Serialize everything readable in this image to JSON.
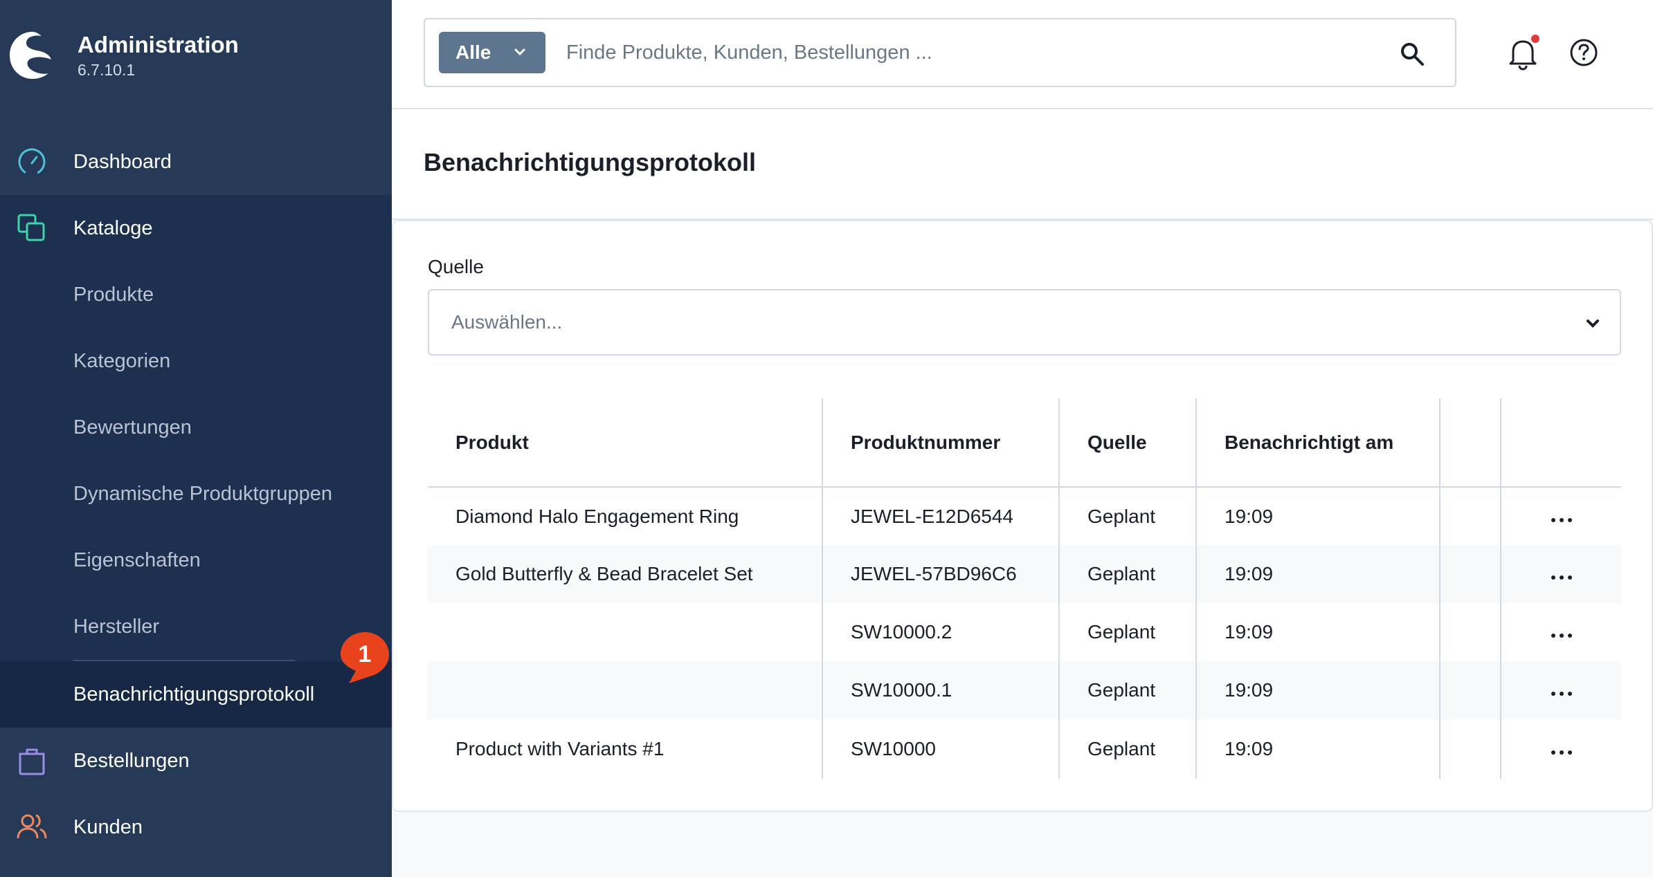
{
  "brand": {
    "name": "Administration",
    "version": "6.7.10.1"
  },
  "nav": {
    "dashboard": "Dashboard",
    "catalogs": "Kataloge",
    "sub_items": [
      "Produkte",
      "Kategorien",
      "Bewertungen",
      "Dynamische Produktgruppen",
      "Eigenschaften",
      "Hersteller",
      "Benachrichtigungsprotokoll"
    ],
    "orders": "Bestellungen",
    "customers": "Kunden",
    "badge": "1"
  },
  "search": {
    "scope": "Alle",
    "placeholder": "Finde Produkte, Kunden, Bestellungen ..."
  },
  "page": {
    "title": "Benachrichtigungsprotokoll"
  },
  "filter": {
    "label": "Quelle",
    "placeholder": "Auswählen..."
  },
  "table": {
    "headers": [
      "Produkt",
      "Produktnummer",
      "Quelle",
      "Benachrichtigt am"
    ],
    "rows": [
      {
        "product": "Diamond Halo Engagement Ring",
        "number": "JEWEL-E12D6544",
        "source": "Geplant",
        "notified": "19:09"
      },
      {
        "product": "Gold Butterfly & Bead Bracelet Set",
        "number": "JEWEL-57BD96C6",
        "source": "Geplant",
        "notified": "19:09"
      },
      {
        "product": "",
        "number": "SW10000.2",
        "source": "Geplant",
        "notified": "19:09"
      },
      {
        "product": "",
        "number": "SW10000.1",
        "source": "Geplant",
        "notified": "19:09"
      },
      {
        "product": "Product with Variants #1",
        "number": "SW10000",
        "source": "Geplant",
        "notified": "19:09"
      }
    ]
  },
  "colors": {
    "sidebar": "#263a58",
    "accent_dashboard": "#4fc3d9",
    "accent_catalog": "#3ed3a8",
    "accent_orders": "#9c8ce6",
    "accent_customers": "#f08a5d",
    "badge": "#e8431d",
    "bell_dot": "#e23b3b"
  },
  "icons": {
    "dashboard": "gauge-icon",
    "catalogs": "layers-icon",
    "orders": "shopping-bag-icon",
    "customers": "users-icon",
    "search": "search-icon",
    "bell": "bell-icon",
    "help": "help-circle-icon"
  }
}
